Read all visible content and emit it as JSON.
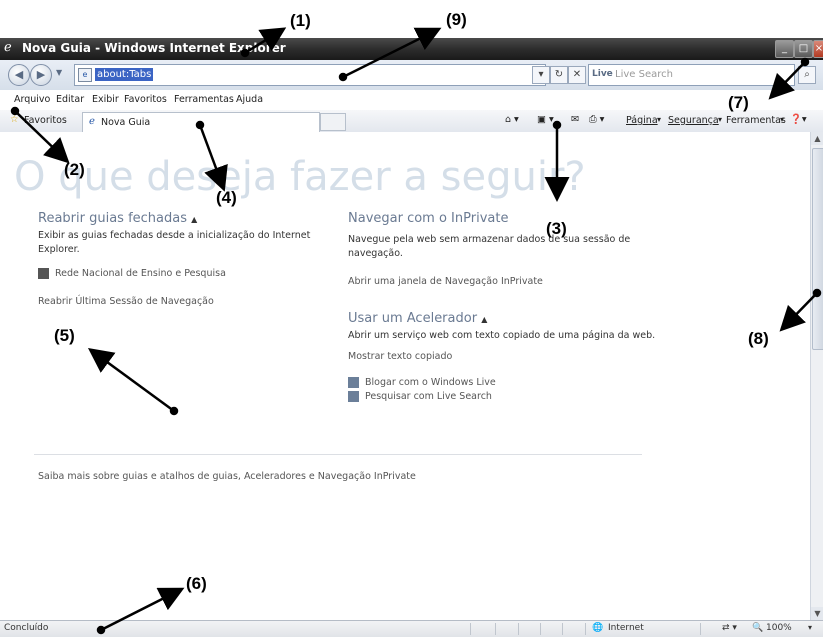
{
  "window": {
    "title": "Nova Guia - Windows Internet Explorer"
  },
  "address": {
    "url": "about:Tabs",
    "search_placeholder": "Live Search",
    "search_brand": "Live"
  },
  "menu": [
    "Arquivo",
    "Editar",
    "Exibir",
    "Favoritos",
    "Ferramentas",
    "Ajuda"
  ],
  "favorites": {
    "label": "Favoritos",
    "tab_label": "Nova Guia"
  },
  "commandbar": {
    "pagina": "Página",
    "seguranca": "Segurança",
    "ferramentas": "Ferramentas"
  },
  "content": {
    "big_title": "O que deseja fazer a seguir?",
    "reopen": {
      "heading": "Reabrir guias fechadas",
      "text": "Exibir as guias fechadas desde a inicialização do Internet Explorer.",
      "item": "Rede Nacional de Ensino e Pesquisa",
      "last_session": "Reabrir Última Sessão de Navegação"
    },
    "inprivate": {
      "heading": "Navegar com o InPrivate",
      "text": "Navegue pela web sem armazenar dados de sua sessão de navegação.",
      "link": "Abrir uma janela de Navegação InPrivate"
    },
    "accelerator": {
      "heading": "Usar um Acelerador",
      "text": "Abrir um serviço web com texto copiado de uma página da web.",
      "show_copied": "Mostrar texto copiado",
      "blog": "Blogar com o Windows Live",
      "search": "Pesquisar com Live Search"
    },
    "footer": "Saiba mais sobre guias e atalhos de guias, Aceleradores e Navegação InPrivate"
  },
  "status": {
    "left": "Concluído",
    "zone": "Internet",
    "zoom": "100%"
  },
  "annotations": [
    "(1)",
    "(2)",
    "(3)",
    "(4)",
    "(5)",
    "(6)",
    "(7)",
    "(8)",
    "(9)"
  ]
}
